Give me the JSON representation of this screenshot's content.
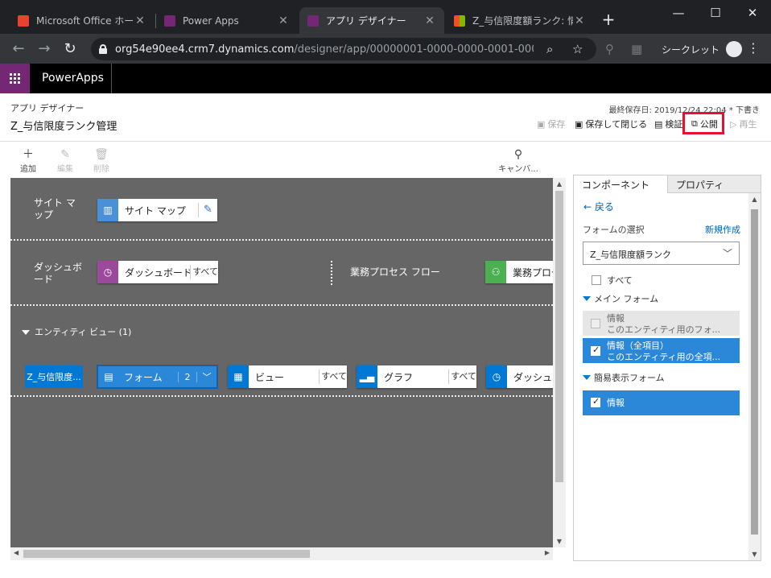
{
  "browser": {
    "tabs": [
      {
        "title": "Microsoft Office ホーム",
        "favicon_color": "#e8432f"
      },
      {
        "title": "Power Apps",
        "favicon_color": "#742774"
      },
      {
        "title": "アプリ デザイナー",
        "favicon_color": "#742774"
      },
      {
        "title": "Z_与信限度額ランク: 情",
        "favicon_color": "#f25022"
      }
    ],
    "url_host": "org54e90ee4.crm7.dynamics.com",
    "url_path": "/designer/app/00000001-0000-0000-0001-00000...",
    "incognito_label": "シークレット"
  },
  "powerapps": {
    "brand": "PowerApps",
    "accent": "#742774"
  },
  "designer": {
    "kind": "アプリ デザイナー",
    "title": "Z_与信限度ランク管理",
    "last_saved": "最終保存日: 2019/12/24 22:04 * 下書き",
    "commands": {
      "save": "保存",
      "save_close": "保存して閉じる",
      "validate": "検証",
      "publish": "公開",
      "play": "再生"
    }
  },
  "canvas_toolbar": {
    "add": "追加",
    "edit": "編集",
    "delete": "削除",
    "canvas": "キャンバ..."
  },
  "canvas": {
    "sitemap_label": "サイト マップ",
    "sitemap_tile": "サイト マップ",
    "dashboard_label": "ダッシュボード",
    "dashboard_tile": "ダッシュボード",
    "dashboard_all": "すべて",
    "bpf_label": "業務プロセス フロー",
    "bpf_tile": "業務プロセ",
    "entity_view_label": "エンティティ ビュー (1)",
    "entity_name": "Z_与信限度...",
    "form_tile": "フォーム",
    "form_count": "2",
    "view_tile": "ビュー",
    "view_all": "すべて",
    "chart_tile": "グラフ",
    "chart_all": "すべて",
    "entity_dashboard_tile": "ダッシュボ"
  },
  "panel": {
    "tab_components": "コンポーネント",
    "tab_properties": "プロパティ",
    "back": "戻る",
    "form_select": "フォームの選択",
    "new": "新規作成",
    "selected_entity": "Z_与信限度額ランク",
    "all": "すべて",
    "main_forms_head": "メイン フォーム",
    "main_forms": [
      {
        "name": "情報",
        "desc": "このエンティティ用のフォ...",
        "checked": false
      },
      {
        "name": "情報（全項目）",
        "desc": "このエンティティ用の全項...",
        "checked": true
      }
    ],
    "quick_forms_head": "簡易表示フォーム",
    "quick_forms": [
      {
        "name": "情報",
        "checked": true
      }
    ]
  },
  "colors": {
    "highlight": "#e8102a",
    "sitemap_icon": "#4a90d9",
    "dashboard_icon": "#9b4a9b",
    "bpf_icon": "#4caf50",
    "form_blue": "#2b88d8"
  }
}
